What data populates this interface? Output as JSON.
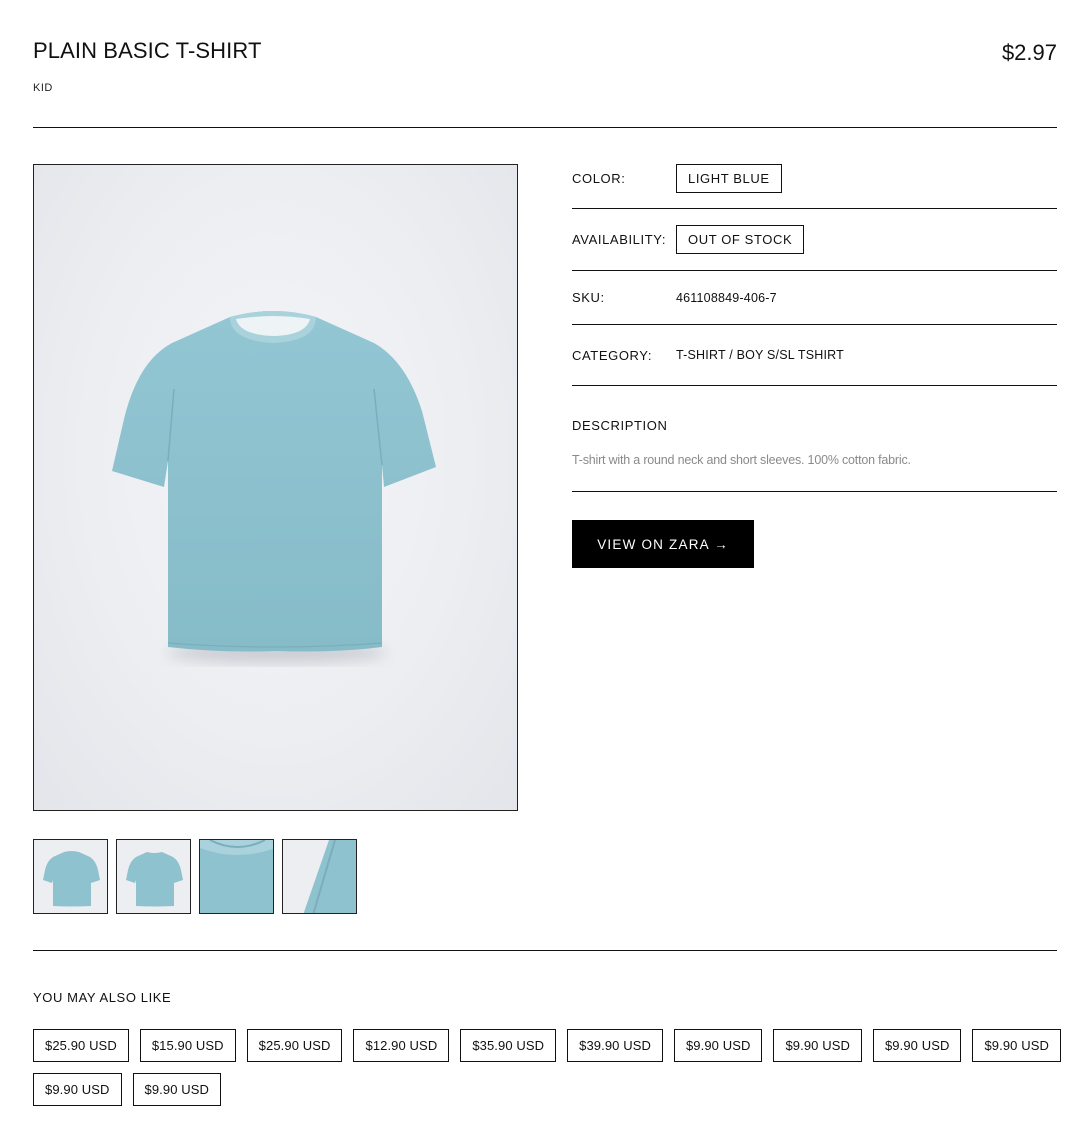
{
  "product": {
    "title": "PLAIN BASIC T-SHIRT",
    "section": "KID",
    "price": "$2.97"
  },
  "details": {
    "color_label": "COLOR:",
    "color_value": "LIGHT BLUE",
    "availability_label": "AVAILABILITY:",
    "availability_value": "OUT OF STOCK",
    "sku_label": "SKU:",
    "sku_value": "461108849-406-7",
    "category_label": "CATEGORY:",
    "category_value": "T-SHIRT / BOY S/SL TSHIRT"
  },
  "description": {
    "title": "DESCRIPTION",
    "text": "T-shirt with a round neck and short sleeves. 100% cotton fabric."
  },
  "cta": {
    "label": "VIEW ON ZARA →"
  },
  "related": {
    "title": "YOU MAY ALSO LIKE",
    "items": [
      "$25.90 USD",
      "$15.90 USD",
      "$25.90 USD",
      "$12.90 USD",
      "$35.90 USD",
      "$39.90 USD",
      "$9.90 USD",
      "$9.90 USD",
      "$9.90 USD",
      "$9.90 USD",
      "$9.90 USD",
      "$9.90 USD"
    ]
  },
  "colors": {
    "shirt": "#8fc2cf",
    "shirt_shade": "#7fb3c1",
    "background": "#eceef2",
    "cta_bg": "#000000",
    "muted_text": "#8a8a8a"
  }
}
